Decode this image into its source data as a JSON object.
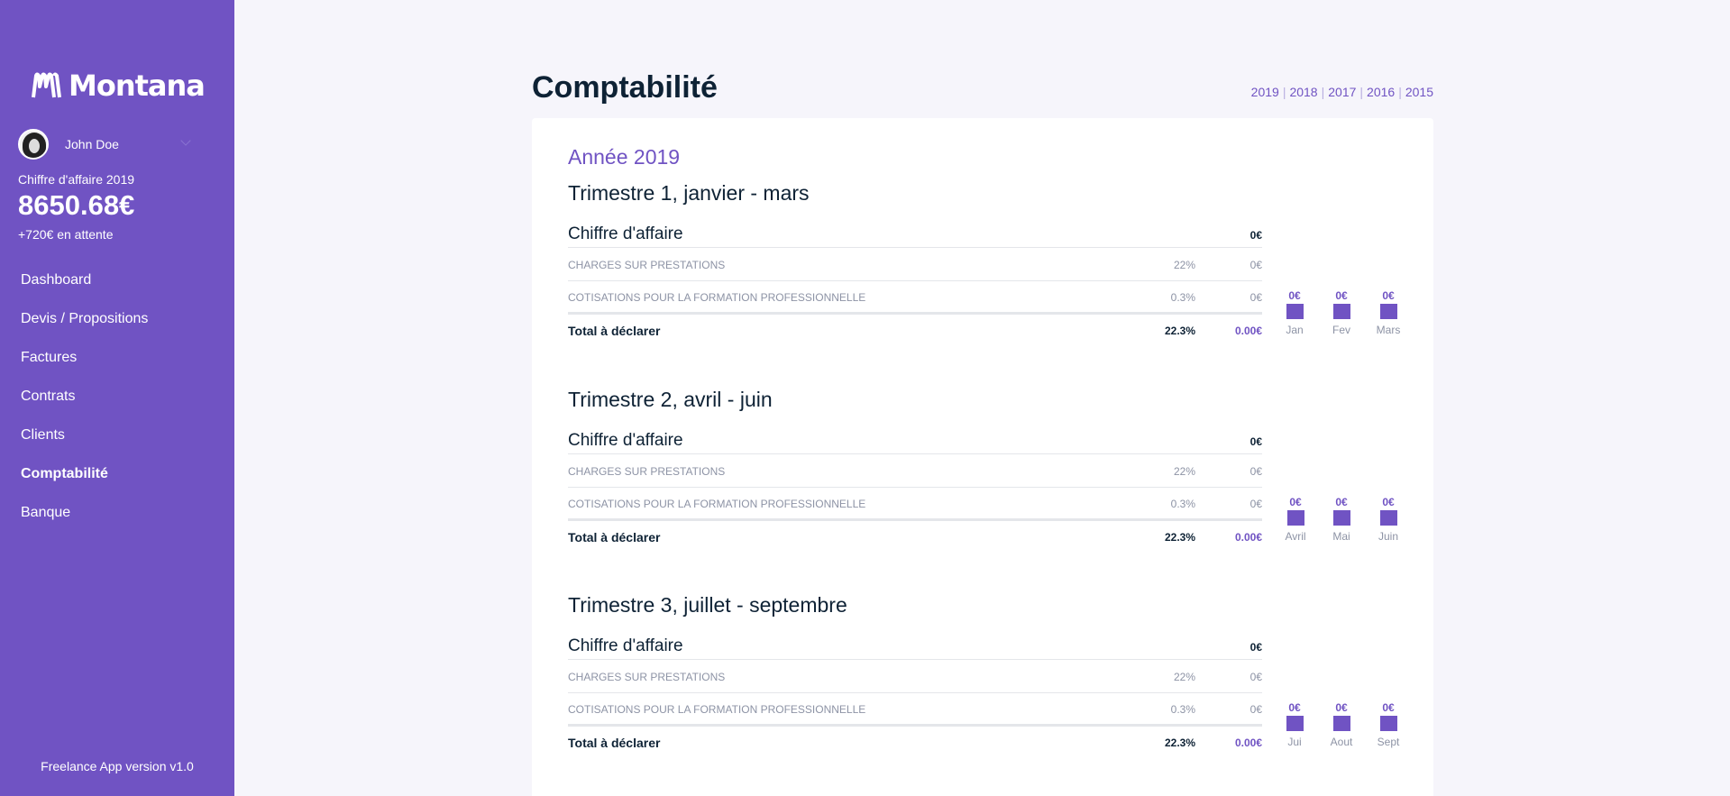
{
  "app": {
    "name": "Montana",
    "version": "Freelance App version v1.0"
  },
  "user": {
    "name": "John Doe",
    "revenue_label": "Chiffre d'affaire 2019",
    "revenue_value": "8650.68€",
    "pending": "+720€ en attente"
  },
  "nav": [
    {
      "label": "Dashboard",
      "active": false
    },
    {
      "label": "Devis / Propositions",
      "active": false
    },
    {
      "label": "Factures",
      "active": false
    },
    {
      "label": "Contrats",
      "active": false
    },
    {
      "label": "Clients",
      "active": false
    },
    {
      "label": "Comptabilité",
      "active": true
    },
    {
      "label": "Banque",
      "active": false
    }
  ],
  "page": {
    "title": "Comptabilité",
    "years": [
      "2019",
      "2018",
      "2017",
      "2016",
      "2015"
    ],
    "year_title": "Année 2019"
  },
  "quarters": [
    {
      "title": "Trimestre 1, janvier - mars",
      "ca_label": "Chiffre d'affaire",
      "ca_value": "0€",
      "charges_label": "CHARGES SUR PRESTATIONS",
      "charges_pct": "22%",
      "charges_value": "0€",
      "cotis_label": "COTISATIONS POUR LA FORMATION PROFESSIONNELLE",
      "cotis_pct": "0.3%",
      "cotis_value": "0€",
      "total_label": "Total à déclarer",
      "total_pct": "22.3%",
      "total_value": "0.00€",
      "months": [
        {
          "value": "0€",
          "label": "Jan"
        },
        {
          "value": "0€",
          "label": "Fev"
        },
        {
          "value": "0€",
          "label": "Mars"
        }
      ]
    },
    {
      "title": "Trimestre 2, avril - juin",
      "ca_label": "Chiffre d'affaire",
      "ca_value": "0€",
      "charges_label": "CHARGES SUR PRESTATIONS",
      "charges_pct": "22%",
      "charges_value": "0€",
      "cotis_label": "COTISATIONS POUR LA FORMATION PROFESSIONNELLE",
      "cotis_pct": "0.3%",
      "cotis_value": "0€",
      "total_label": "Total à déclarer",
      "total_pct": "22.3%",
      "total_value": "0.00€",
      "months": [
        {
          "value": "0€",
          "label": "Avril"
        },
        {
          "value": "0€",
          "label": "Mai"
        },
        {
          "value": "0€",
          "label": "Juin"
        }
      ]
    },
    {
      "title": "Trimestre 3, juillet - septembre",
      "ca_label": "Chiffre d'affaire",
      "ca_value": "0€",
      "charges_label": "CHARGES SUR PRESTATIONS",
      "charges_pct": "22%",
      "charges_value": "0€",
      "cotis_label": "COTISATIONS POUR LA FORMATION PROFESSIONNELLE",
      "cotis_pct": "0.3%",
      "cotis_value": "0€",
      "total_label": "Total à déclarer",
      "total_pct": "22.3%",
      "total_value": "0.00€",
      "months": [
        {
          "value": "0€",
          "label": "Jui"
        },
        {
          "value": "0€",
          "label": "Aout"
        },
        {
          "value": "0€",
          "label": "Sept"
        }
      ]
    }
  ],
  "colors": {
    "brand": "#7053c3",
    "text_dark": "#0e2235",
    "text_muted": "#8d93a5",
    "background": "#f6f5fb"
  }
}
